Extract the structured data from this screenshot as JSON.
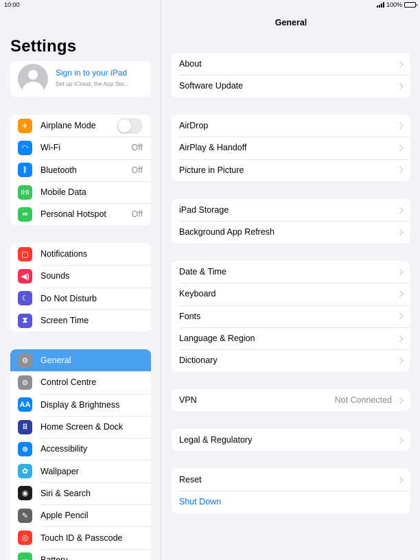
{
  "status_bar": {
    "time": "10:00",
    "battery": "100%"
  },
  "sidebar": {
    "title": "Settings",
    "profile": {
      "title": "Sign in to your iPad",
      "subtitle": "Set up iCloud, the App Sto..."
    },
    "groups": [
      [
        {
          "label": "Airplane Mode",
          "icon": "airplane-icon",
          "color": "#ff9500",
          "toggle": true
        },
        {
          "label": "Wi-Fi",
          "icon": "wifi-icon",
          "color": "#0a84ff",
          "value": "Off"
        },
        {
          "label": "Bluetooth",
          "icon": "bluetooth-icon",
          "color": "#0a84ff",
          "value": "Off"
        },
        {
          "label": "Mobile Data",
          "icon": "antenna-icon",
          "color": "#34c759"
        },
        {
          "label": "Personal Hotspot",
          "icon": "hotspot-icon",
          "color": "#34c759",
          "value": "Off"
        }
      ],
      [
        {
          "label": "Notifications",
          "icon": "notifications-icon",
          "color": "#ff3b30"
        },
        {
          "label": "Sounds",
          "icon": "speaker-icon",
          "color": "#ff2d55"
        },
        {
          "label": "Do Not Disturb",
          "icon": "moon-icon",
          "color": "#5856d6"
        },
        {
          "label": "Screen Time",
          "icon": "hourglass-icon",
          "color": "#5856d6"
        }
      ],
      [
        {
          "label": "General",
          "icon": "gear-icon",
          "color": "#8e8e93",
          "selected": true
        },
        {
          "label": "Control Centre",
          "icon": "toggles-icon",
          "color": "#8e8e93"
        },
        {
          "label": "Display & Brightness",
          "icon": "text-size-icon",
          "color": "#0a84ff"
        },
        {
          "label": "Home Screen & Dock",
          "icon": "grid-icon",
          "color": "#2c3e9e"
        },
        {
          "label": "Accessibility",
          "icon": "accessibility-icon",
          "color": "#0a84ff"
        },
        {
          "label": "Wallpaper",
          "icon": "flower-icon",
          "color": "#32ade6"
        },
        {
          "label": "Siri & Search",
          "icon": "siri-icon",
          "color": "#1c1c1e"
        },
        {
          "label": "Apple Pencil",
          "icon": "pencil-icon",
          "color": "#636366"
        },
        {
          "label": "Touch ID & Passcode",
          "icon": "fingerprint-icon",
          "color": "#ff3b30"
        },
        {
          "label": "Battery",
          "icon": "battery-icon",
          "color": "#34c759"
        }
      ]
    ]
  },
  "main": {
    "title": "General",
    "groups": [
      [
        {
          "label": "About"
        },
        {
          "label": "Software Update"
        }
      ],
      [
        {
          "label": "AirDrop"
        },
        {
          "label": "AirPlay & Handoff"
        },
        {
          "label": "Picture in Picture"
        }
      ],
      [
        {
          "label": "iPad Storage"
        },
        {
          "label": "Background App Refresh"
        }
      ],
      [
        {
          "label": "Date & Time"
        },
        {
          "label": "Keyboard"
        },
        {
          "label": "Fonts"
        },
        {
          "label": "Language & Region"
        },
        {
          "label": "Dictionary"
        }
      ],
      [
        {
          "label": "VPN",
          "value": "Not Connected"
        }
      ],
      [
        {
          "label": "Legal & Regulatory"
        }
      ],
      [
        {
          "label": "Reset"
        },
        {
          "label": "Shut Down",
          "link": true
        }
      ]
    ]
  }
}
